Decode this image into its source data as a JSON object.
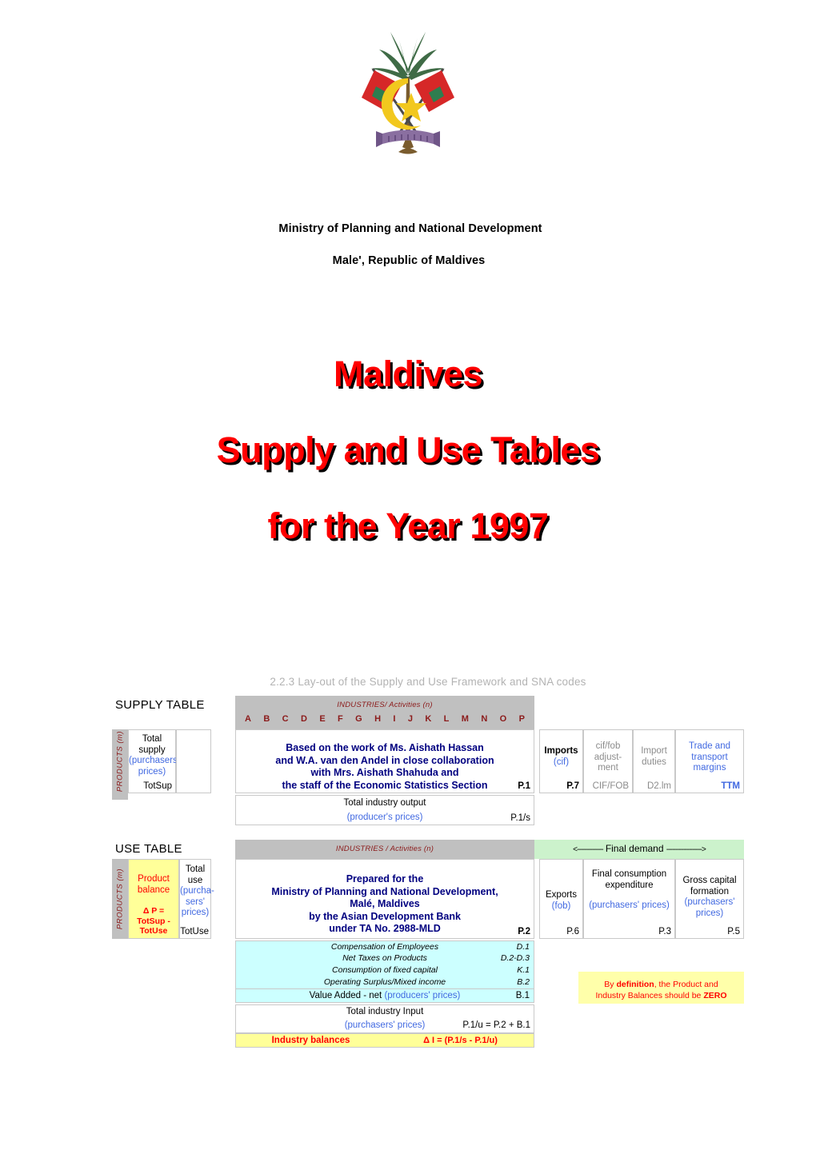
{
  "emblem": {
    "name": "maldives-national-emblem",
    "elements": [
      "coconut-palm",
      "crescent",
      "star",
      "two-national-flags",
      "scroll-banner"
    ]
  },
  "header": {
    "line1": "Ministry of Planning and National Development",
    "line2": "Male', Republic of Maldives"
  },
  "title": {
    "line1": "Maldives",
    "line2": "Supply and Use Tables",
    "line3": "for the Year 1997",
    "color": "#ff0000",
    "shadow_color": "#000000"
  },
  "diagram": {
    "caption": "2.2.3  Lay-out of the Supply and Use Framework and SNA codes",
    "caption_color": "#b3b3b3",
    "industry_letters": [
      "A",
      "B",
      "C",
      "D",
      "E",
      "F",
      "G",
      "H",
      "I",
      "J",
      "K",
      "L",
      "M",
      "N",
      "O",
      "P"
    ],
    "supply": {
      "table_label": "SUPPLY TABLE",
      "industries_band": "INDUSTRIES/ Activities   (n)",
      "products_axis": "PRODUCTS (m)",
      "total_supply": {
        "l1": "Total",
        "l2": "supply",
        "l3": "(purchasers'",
        "l4": "prices)",
        "code": "TotSup"
      },
      "center_note": {
        "l1": "Based on the work of Ms. Aishath Hassan",
        "l2": "and W.A. van den Andel in close collaboration",
        "l3": "with Mrs. Aishath Shahuda and",
        "l4": "the staff of the Economic Statistics Section",
        "code": "P.1"
      },
      "imports": {
        "l1": "Imports",
        "l2": "(cif)",
        "code": "P.7"
      },
      "ciffob": {
        "l1": "cif/fob",
        "l2": "adjust-",
        "l3": "ment",
        "code": "CIF/FOB"
      },
      "duties": {
        "l1": "Import",
        "l2": "duties",
        "code": "D2.lm"
      },
      "margins": {
        "l1": "Trade and",
        "l2": "transport",
        "l3": "margins",
        "code": "TTM"
      },
      "output_row": {
        "l1": "Total industry output",
        "l2": "(producer's prices)",
        "code": "P.1/s"
      }
    },
    "use": {
      "table_label": "USE TABLE",
      "industries_band": "INDUSTRIES / Activities   (n)",
      "final_demand_band": "Final demand",
      "products_axis": "PRODUCTS (m)",
      "product_balance": {
        "l1": "Product",
        "l2": "balance",
        "f1": "Δ P =",
        "f2": "TotSup -",
        "f3": "TotUse"
      },
      "total_use": {
        "l1": "Total",
        "l2": "use",
        "l3": "(purcha-",
        "l4": "sers'",
        "l5": "prices)",
        "code": "TotUse"
      },
      "center_note": {
        "l1": "Prepared for the",
        "l2": "Ministry of Planning and National Development,",
        "l3": "Malé, Maldives",
        "l4": "by the Asian Development Bank",
        "l5": "under TA No. 2988-MLD",
        "code": "P.2"
      },
      "exports": {
        "l1": "Exports",
        "l2": "(fob)",
        "code": "P.6"
      },
      "final_consumption": {
        "l1": "Final consumption",
        "l2": "expenditure",
        "l3": "(purchasers' prices)",
        "code": "P.3"
      },
      "gross_capital": {
        "l1": "Gross capital",
        "l2": "formation",
        "l3": "(purchasers'",
        "l4": "prices)",
        "code": "P.5"
      },
      "value_added_rows": [
        {
          "label": "Compensation of Employees",
          "code": "D.1"
        },
        {
          "label": "Net Taxes on Products",
          "code": "D.2-D.3"
        },
        {
          "label": "Consumption of fixed capital",
          "code": "K.1"
        },
        {
          "label": "Operating Surplus/Mixed income",
          "code": "B.2"
        }
      ],
      "value_added_total": {
        "label_main": "Value Added - net ",
        "label_paren": "(producers' prices)",
        "code": "B.1"
      },
      "total_input": {
        "l1": "Total industry Input",
        "l2": "(purchasers' prices)",
        "code": "P.1/u = P.2 + B.1"
      },
      "industry_balances": {
        "label": "Industry balances",
        "formula": "Δ I = (P.1/s - P.1/u)"
      },
      "note": {
        "pre": "By ",
        "bold1": "definition",
        "mid": ", the Product and",
        "l2a": "Industry Balances should be ",
        "bold2": "ZERO"
      }
    }
  }
}
